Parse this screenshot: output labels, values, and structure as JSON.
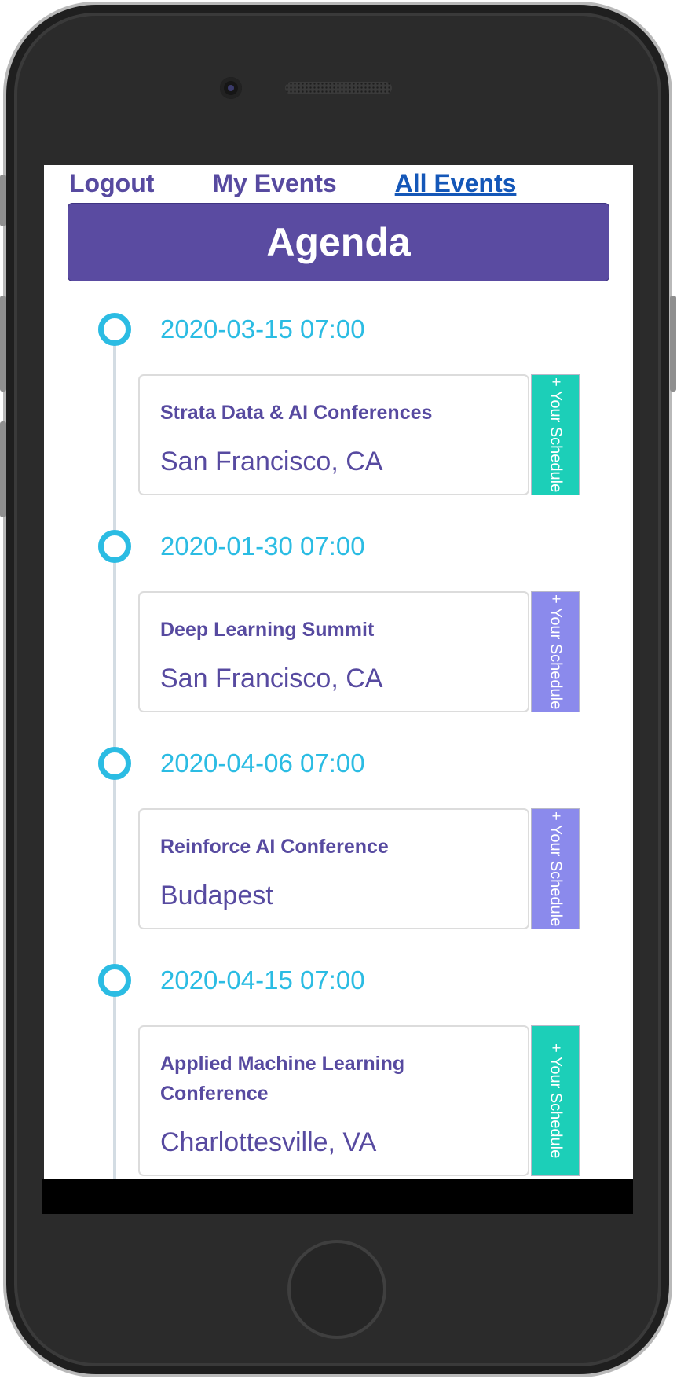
{
  "nav": {
    "logout_label": "Logout",
    "my_events_label": "My Events",
    "all_events_label": "All Events"
  },
  "header": {
    "title": "Agenda"
  },
  "events": [
    {
      "date": "2020-03-15 07:00",
      "title": "Strata Data & AI Conferences",
      "location": "San Francisco, CA",
      "button_label": "+ Your Schedule"
    },
    {
      "date": "2020-01-30 07:00",
      "title": "Deep Learning Summit",
      "location": "San Francisco, CA",
      "button_label": "+ Your Schedule"
    },
    {
      "date": "2020-04-06 07:00",
      "title": "Reinforce AI Conference",
      "location": "Budapest",
      "button_label": "+ Your Schedule"
    },
    {
      "date": "2020-04-15 07:00",
      "title": "Applied Machine Learning Conference",
      "location": "Charlottesville, VA",
      "button_label": "+ Your Schedule"
    }
  ],
  "colors": {
    "primary": "#574aa0",
    "header_bg": "#5a4ba1",
    "timeline_accent": "#2bbce3",
    "schedule_teal": "#1ccfb8",
    "schedule_lavender": "#8b8aec"
  }
}
